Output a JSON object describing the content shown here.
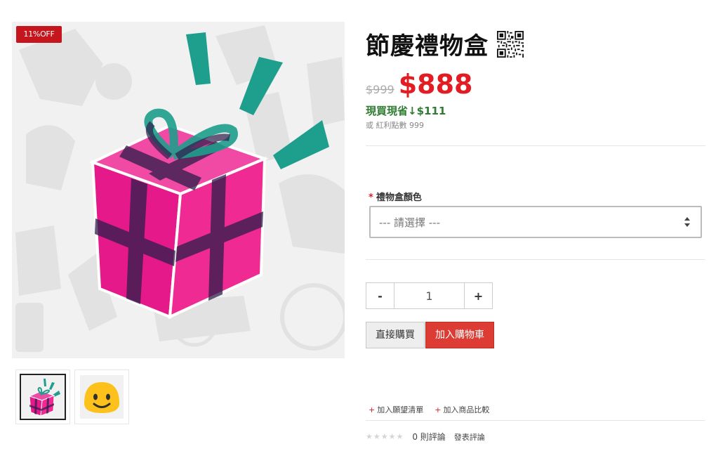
{
  "product": {
    "title": "節慶禮物盒",
    "discount_badge": "11%OFF",
    "old_price": "$999",
    "price": "$888",
    "saving_text": "現買現省↓$111",
    "bonus_points": "或 紅利點數 999",
    "qr_icon": "qr-code-icon"
  },
  "options": {
    "label": "禮物盒顏色",
    "required_mark": "*",
    "select_placeholder": "--- 請選擇 ---"
  },
  "quantity": {
    "minus_label": "-",
    "value": "1",
    "plus_label": "+"
  },
  "actions": {
    "buy_now_label": "直接購買",
    "add_to_cart_label": "加入購物車"
  },
  "links": {
    "plus_mark": "+",
    "wishlist_label": "加入願望清單",
    "compare_label": "加入商品比較"
  },
  "reviews": {
    "stars": "★★★★★",
    "rating": 0,
    "count_label": "0 則評論",
    "write_label": "發表評論"
  },
  "colors": {
    "accent": "#e31c23",
    "cart_button": "#dc3c34",
    "saving": "#2e7d32",
    "gift_pink": "#e6198a",
    "ribbon_dark": "#2c1d4a",
    "sparkle_teal": "#1e9e8c"
  },
  "thumbnails": [
    {
      "icon": "gift-box-icon",
      "active": true
    },
    {
      "icon": "smiley-face-icon",
      "active": false
    }
  ]
}
